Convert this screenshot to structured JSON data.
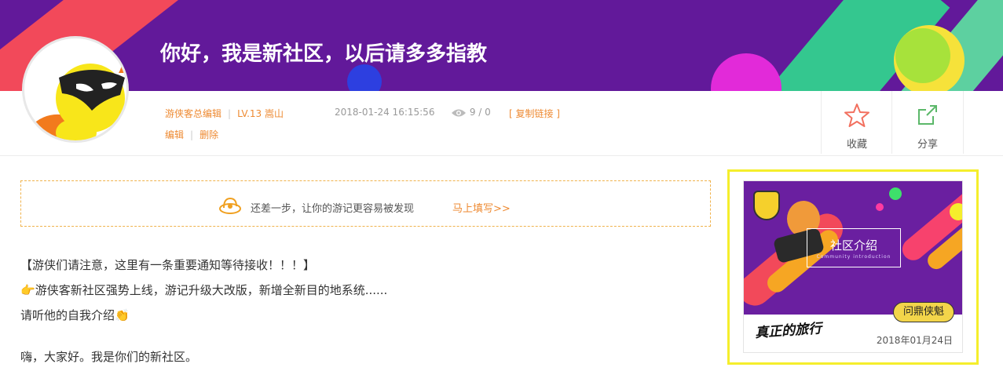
{
  "banner": {
    "title": "你好，我是新社区，以后请多多指教"
  },
  "author": {
    "name": "游侠客总编辑",
    "level": "LV.13 嵩山",
    "edit": "编辑",
    "delete": "删除"
  },
  "post_meta": {
    "datetime": "2018-01-24 16:15:56",
    "views": "9 / 0",
    "copy_link": "[ 复制链接 ]"
  },
  "actions": {
    "favorite": "收藏",
    "share": "分享"
  },
  "tip": {
    "text": "还差一步，让你的游记更容易被发现",
    "link": "马上填写>>"
  },
  "content": {
    "line1": "【游侠们请注意，这里有一条重要通知等待接收！！！】",
    "line2": "游侠客新社区强势上线，游记升级大改版，新增全新目的地系统......",
    "line3": "请听他的自我介绍",
    "line4": "嗨，大家好。我是你们的新社区。"
  },
  "card": {
    "image_title": "社区介绍",
    "image_subtitle": "Community introduction",
    "badge": "问鼎侠魁",
    "signature": "真正的旅行",
    "date": "2018年01月24日"
  },
  "colors": {
    "accent": "#ee8a32",
    "banner": "#62199a",
    "highlight": "#f5ee2c"
  }
}
